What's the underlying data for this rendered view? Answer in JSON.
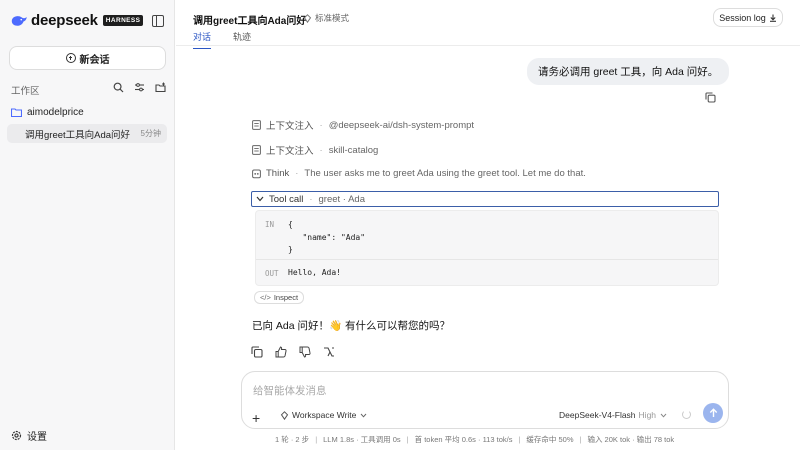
{
  "sidebar": {
    "logo_text": "deepseek",
    "badge": "HARNESS",
    "new_chat_label": "新会话",
    "workspace_label": "工作区",
    "folder_name": "aimodelprice",
    "session": {
      "title": "调用greet工具向Ada问好",
      "time": "5分钟"
    },
    "settings_label": "设置"
  },
  "header": {
    "title": "调用greet工具向Ada问好",
    "mode_label": "标准模式",
    "tabs": [
      {
        "label": "对话"
      },
      {
        "label": "轨迹"
      }
    ],
    "session_log_label": "Session log"
  },
  "chat": {
    "user_message": "请务必调用 greet 工具，向 Ada 问好。",
    "context_rows": [
      {
        "label": "上下文注入",
        "meta": "@deepseek-ai/dsh-system-prompt"
      },
      {
        "label": "上下文注入",
        "meta": "skill-catalog"
      }
    ],
    "think": {
      "label": "Think",
      "meta": "The user asks me to greet Ada using the greet tool. Let me do that."
    },
    "tool_call": {
      "label": "Tool call",
      "meta": "greet · Ada"
    },
    "io": {
      "in_label": "IN",
      "in_json": "{\n   \"name\": \"Ada\"\n}",
      "out_label": "OUT",
      "out_value": "Hello, Ada!"
    },
    "inspect_label": "Inspect",
    "answer": "已向 Ada 问好！👋 有什么可以帮您的吗？"
  },
  "composer": {
    "placeholder": "给智能体发消息",
    "plus": "+",
    "workspace_mode": "Workspace Write",
    "model": "DeepSeek-V4-Flash",
    "level": "High"
  },
  "stats": [
    "1 轮 · 2 步",
    "LLM 1.8s · 工具调用 0s",
    "首 token 平均 0.6s · 113 tok/s",
    "缓存命中 50%",
    "输入 20K tok · 输出 78 tok"
  ],
  "colors": {
    "accent": "#2b56c4",
    "send_button": "#9bb5ee",
    "tool_call_border": "#3b5ea8"
  }
}
